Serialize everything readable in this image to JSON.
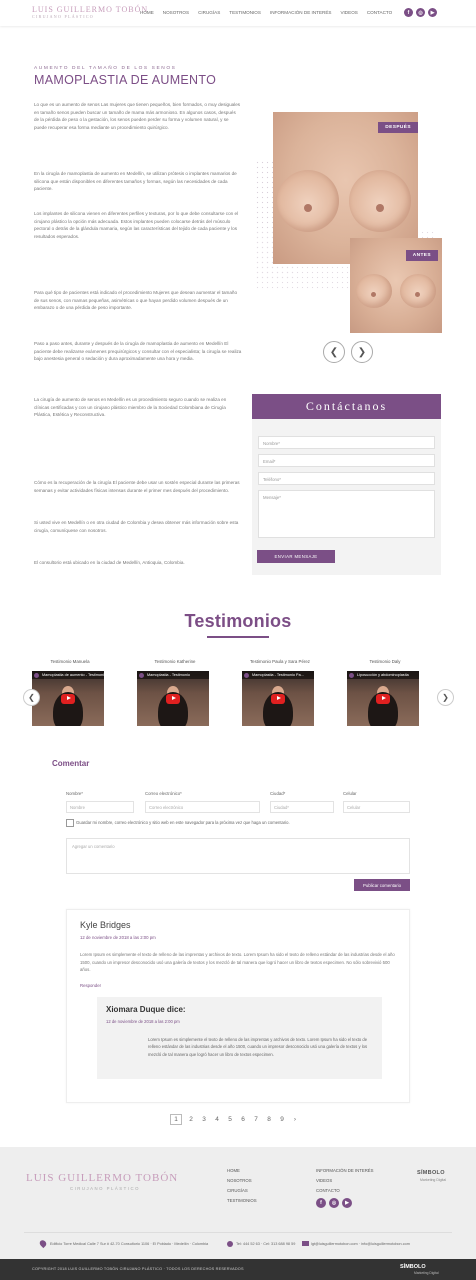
{
  "header": {
    "logo_name": "LUIS GUILLERMO TOBÓN",
    "logo_sub": "CIRUJANO PLÁSTICO",
    "nav": [
      "HOME",
      "NOSOTROS",
      "CIRUGÍAS",
      "TESTIMONIOS",
      "INFORMACIÓN DE INTERÉS",
      "VIDEOS",
      "CONTACTO"
    ],
    "social": [
      "f",
      "◎",
      "▶"
    ]
  },
  "article": {
    "kicker": "AUMENTO DEL TAMAÑO DE LOS SENOS",
    "title": "MAMOPLASTIA DE AUMENTO",
    "paragraphs": [
      "Lo que es un aumento de senos\nLas mujeres que tienen pequeños, bien formados, o muy desiguales en tamaño senos pueden buscar un tamaño de mama más armonioso. En algunos casos, después de la pérdida de peso o la gestación, los senos pueden perder su forma y volumen natural, y se puede recuperar esa forma mediante un procedimiento quirúrgico.",
      "En la cirugía de mamoplastia de aumento en Medellín, se utilizan prótesis o implantes mamarios de silicona que están disponibles en diferentes tamaños y formas, según las necesidades de cada paciente.",
      "Los implantes de silicona vienen en diferentes perfiles y texturas, por lo que debe consultarse con el cirujano plástico la opción más adecuada. Estos implantes pueden colocarse detrás del músculo pectoral o detrás de la glándula mamaria, según las características del tejido de cada paciente y los resultados esperados.",
      "Para qué tipo de pacientes está indicado el procedimiento\nMujeres que desean aumentar el tamaño de sus senos, con mamas pequeñas, asimétricas o que hayan perdido volumen después de un embarazo o de una pérdida de peso importante.",
      "Paso a paso antes, durante y después de la cirugía de mamoplastia de aumento en Medellín\nEl paciente debe realizarse exámenes prequirúrgicos y consultar con el especialista; la cirugía se realiza bajo anestesia general o sedación y dura aproximadamente una hora y media.",
      "La cirugía de aumento de senos en Medellín es un procedimiento seguro cuando se realiza en clínicas certificadas y con un cirujano plástico miembro de la Sociedad Colombiana de Cirugía Plástica, Estética y Reconstructiva.",
      "Cómo es la recuperación de la cirugía\nEl paciente debe usar un sostén especial durante las primeras semanas y evitar actividades físicas intensas durante el primer mes después del procedimiento.",
      "Si usted vive en Medellín o en otra ciudad de Colombia y desea obtener más información sobre esta cirugía, comuníquese con nosotros.",
      "El consultorio está ubicado en la ciudad de Medellín, Antioquia, Colombia."
    ]
  },
  "gallery": {
    "after_label": "DESPUÉS",
    "before_label": "ANTES",
    "prev": "❮",
    "next": "❯"
  },
  "contact": {
    "title": "Contáctanos",
    "fields": [
      "Nombre*",
      "Email*",
      "Teléfono*",
      "Mensaje*"
    ],
    "send": "ENVIAR MENSAJE"
  },
  "testimonials": {
    "title": "Testimonios",
    "items": [
      {
        "label": "Testimonio Manuela",
        "video": "Mamoplastia de aumento - Testimonio"
      },
      {
        "label": "Testimonio Katherine",
        "video": "Mamoplastia - Testimonio"
      },
      {
        "label": "Testimonio Paula y Sara Pérez",
        "video": "Mamoplastia - Testimonio Pa..."
      },
      {
        "label": "Testimonio Daly",
        "video": "Liposucción y abdominoplastia"
      }
    ],
    "prev": "❮",
    "next": "❯"
  },
  "comments": {
    "title": "Comentar",
    "labels": [
      "Nombre*",
      "Correo electrónico*",
      "Ciudad*",
      "Celular"
    ],
    "placeholders": [
      "Nombre",
      "Correo electrónico",
      "Ciudad*",
      "Celular"
    ],
    "checkbox_text": "Guardar mi nombre, correo electrónico y sitio web en este navegador para la próxima vez que haga un comentario.",
    "textarea_placeholder": "Agregar un comentario",
    "publish": "Publicar comentario",
    "entries": [
      {
        "name": "Kyle Bridges",
        "date": "12 de noviembre de 2018 a las 2:00 pm",
        "text": "Lorem Ipsum es simplemente el texto de relleno de las imprentas y archivos de texto. Lorem Ipsum ha sido el texto de relleno estándar de las industrias desde el año 1500, cuando un impresor desconocido usó una galería de textos y los mezcló de tal manera que logró hacer un libro de textos especimen. No sólo sobrevivió 500 años.",
        "reply": "Responder"
      },
      {
        "name": "Xiomara Duque dice:",
        "date": "12 de noviembre de 2018 a las 2:00 pm",
        "text": "Lorem Ipsum es simplemente el texto de relleno de las imprentas y archivos de texto. Lorem Ipsum ha sido el texto de relleno estándar de las industrias desde el año 1500, cuando un impresor desconocido usó una galería de textos y los mezcló de tal manera que logró hacer un libro de textos especimen."
      }
    ]
  },
  "pagination": {
    "pages": [
      "1",
      "2",
      "3",
      "4",
      "5",
      "6",
      "7",
      "8",
      "9"
    ],
    "next": "›",
    "current": "1"
  },
  "footer": {
    "logo_name": "LUIS GUILLERMO TOBÓN",
    "logo_sub": "CIRUJANO PLÁSTICO",
    "links_col1": [
      "HOME",
      "NOSOTROS",
      "CIRUGÍAS",
      "TESTIMONIOS"
    ],
    "links_col2": [
      "INFORMACIÓN DE INTERÉS",
      "VIDEOS",
      "CONTACTO"
    ],
    "simbolo": "SÍMBOLO",
    "simbolo_sub": "Marketing Digital",
    "address": "Edificio Torre Medical Calle 7 Sur # 42-70 Consultorio 1106 · El Poblado · Medellín · Colombia",
    "phone": "Tel: 444 52 63 · Cel: 313 688 98 59",
    "email": "lgt@luisguillermotobon.com · info@luisguillermotobon.com",
    "copyright": "COPYRIGHT 2018 LUIS GUILLERMO TOBÓN CIRUJANO PLÁSTICO · TODOS LOS DERECHOS RESERVADOS",
    "brand": "SÍMBOLO",
    "brand_sub": "Marketing Digital"
  }
}
